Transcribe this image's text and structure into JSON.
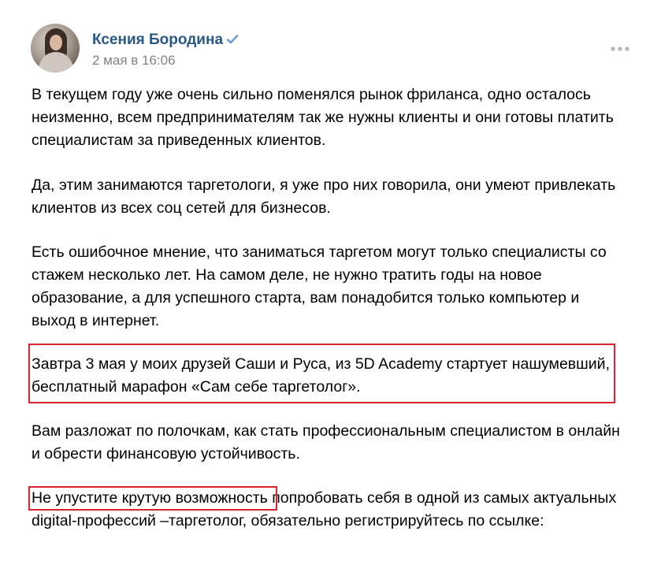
{
  "post": {
    "author": {
      "name": "Ксения Бородина",
      "avatar_icon": "avatar-photo",
      "verified_icon": "verified-checkmark-icon"
    },
    "date": "2 мая в 16:06",
    "menu_icon": "more-dots-icon",
    "paragraphs": [
      {
        "lines": [
          "В текущем году уже очень сильно поменялся рынок фриланса, одно осталось",
          "неизменно, всем предпринимателям так же нужны клиенты и они готовы платить",
          "специалистам за приведенных клиентов."
        ]
      },
      {
        "lines": [
          "Да, этим занимаются таргетологи, я уже про них говорила, они умеют привлекать",
          "клиентов из всех соц сетей для бизнесов."
        ]
      },
      {
        "lines": [
          "Есть ошибочное мнение, что заниматься таргетом могут только специалисты со",
          "стажем несколько лет. На самом деле, не нужно тратить годы на новое",
          "образование, а для успешного старта, вам понадобится только компьютер и",
          "выход в интернет."
        ]
      },
      {
        "lines": [
          "Завтра 3 мая у моих друзей Саши и Руса, из 5D Academy стартует нашумевший,",
          "бесплатный марафон «Сам себе таргетолог»."
        ]
      },
      {
        "lines": [
          "Вам разложат по полочкам, как стать профессиональным специалистом в онлайн",
          "и обрести финансовую устойчивость."
        ]
      },
      {
        "lines": [
          "Не упустите крутую возможность попробовать себя в одной из самых актуальных",
          "digital-профессий –таргетолог, обязательно регистрируйтесь по ссылке:"
        ]
      }
    ]
  },
  "colors": {
    "name_link": "#2a5885",
    "date_text": "#828282",
    "body_text": "#000000",
    "highlight_border": "#d9232e",
    "verified": "#6f9dd1"
  }
}
